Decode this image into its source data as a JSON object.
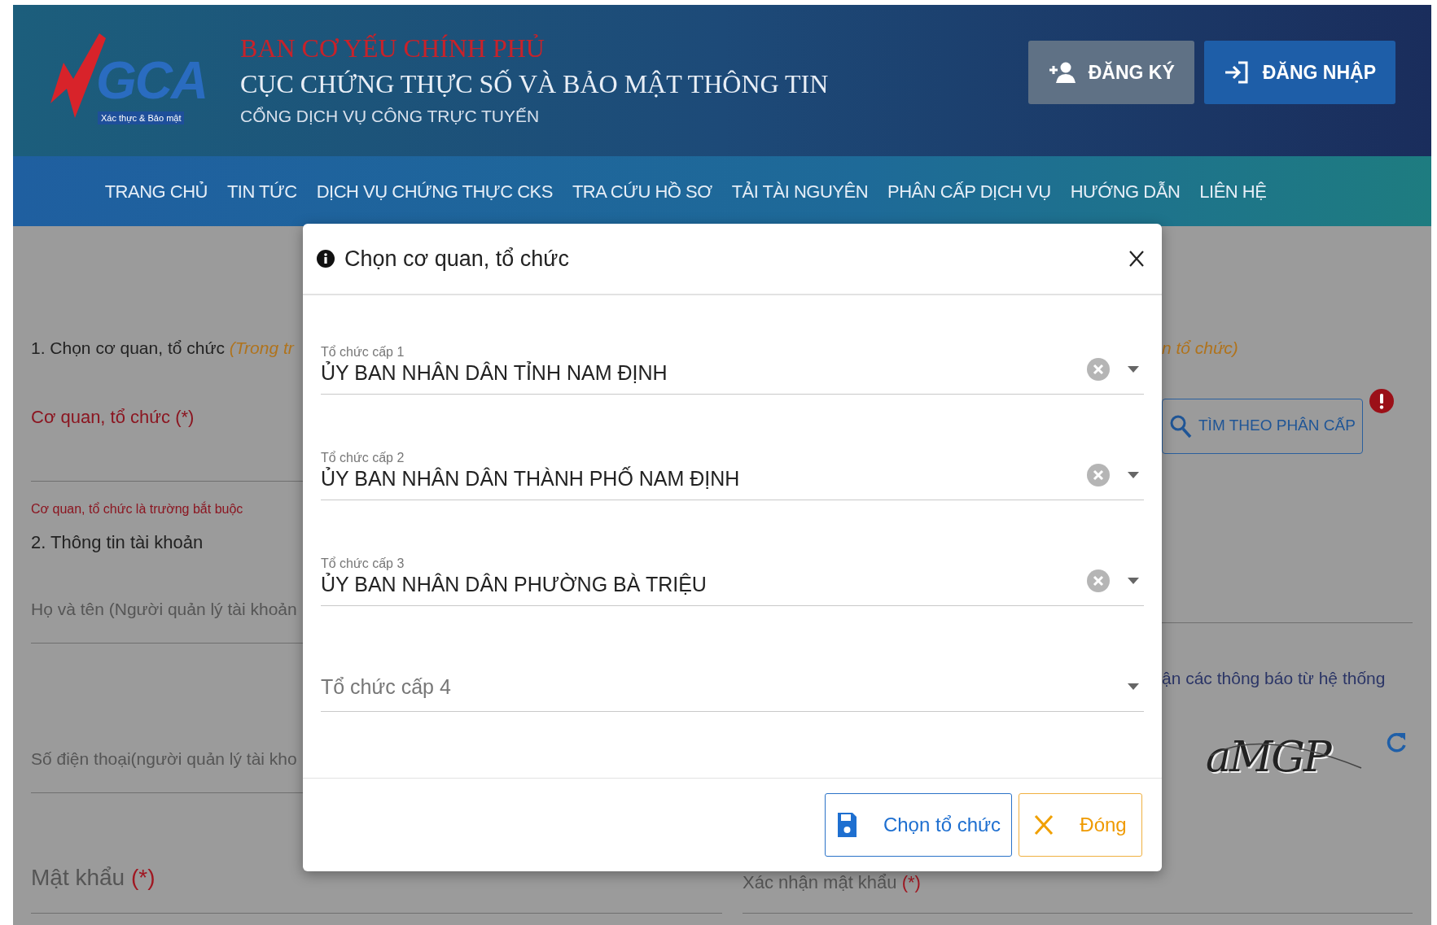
{
  "header": {
    "logo": {
      "text": "GCA",
      "tagline": "Xác thực & Bảo mật"
    },
    "agency": "BAN CƠ YẾU CHÍNH PHỦ",
    "department": "CỤC CHỨNG THỰC SỐ VÀ BẢO MẬT THÔNG TIN",
    "portal": "CỔNG DỊCH VỤ CÔNG TRỰC TUYẾN",
    "buttons": [
      {
        "kind": "register",
        "label": "ĐĂNG KÝ"
      },
      {
        "kind": "login",
        "label": "ĐĂNG NHẬP"
      }
    ]
  },
  "nav": [
    "TRANG CHỦ",
    "TIN TỨC",
    "DỊCH VỤ CHỨNG THỰC CKS",
    "TRA CỨU HỒ SƠ",
    "TẢI TÀI NGUYÊN",
    "PHÂN CẤP DỊCH VỤ",
    "HƯỚNG DẪN",
    "LIÊN HỆ"
  ],
  "form": {
    "section_1": {
      "title": "1. Chọn cơ quan, tổ chức",
      "note_start": "(Trong tr",
      "note_end": "n tổ chức)"
    },
    "org_field": {
      "label": "Cơ quan, tổ chức",
      "required": "(*)",
      "error": "Cơ quan, tổ chức là trường bắt buộc",
      "search_button": "TÌM THEO PHÂN CẤP"
    },
    "section_2": "2. Thông tin tài khoản",
    "name_placeholder": "Họ và tên (Người quản lý tài khoản",
    "phone_placeholder": "Số điện thoại(người quản lý tài kho",
    "notify_text": "ận các thông báo từ hệ thống",
    "captcha": "aMGP",
    "password": {
      "label": "Mật khẩu",
      "required": "(*)"
    },
    "confirm_password": {
      "label": "Xác nhận mật khẩu",
      "required": "(*)"
    }
  },
  "dialog": {
    "title": "Chọn cơ quan, tổ chức",
    "fields": [
      {
        "label": "Tổ chức cấp 1",
        "value": "ỦY BAN NHÂN DÂN TỈNH NAM ĐỊNH"
      },
      {
        "label": "Tổ chức cấp 2",
        "value": "ỦY BAN NHÂN DÂN THÀNH PHỐ NAM ĐỊNH"
      },
      {
        "label": "Tổ chức cấp 3",
        "value": "ỦY BAN NHÂN DÂN PHƯỜNG BÀ TRIỆU"
      },
      {
        "label": "Tổ chức cấp 4"
      }
    ],
    "buttons": [
      {
        "kind": "primary",
        "label": "Chọn tổ chức"
      },
      {
        "kind": "close",
        "label": "Đóng"
      }
    ]
  }
}
